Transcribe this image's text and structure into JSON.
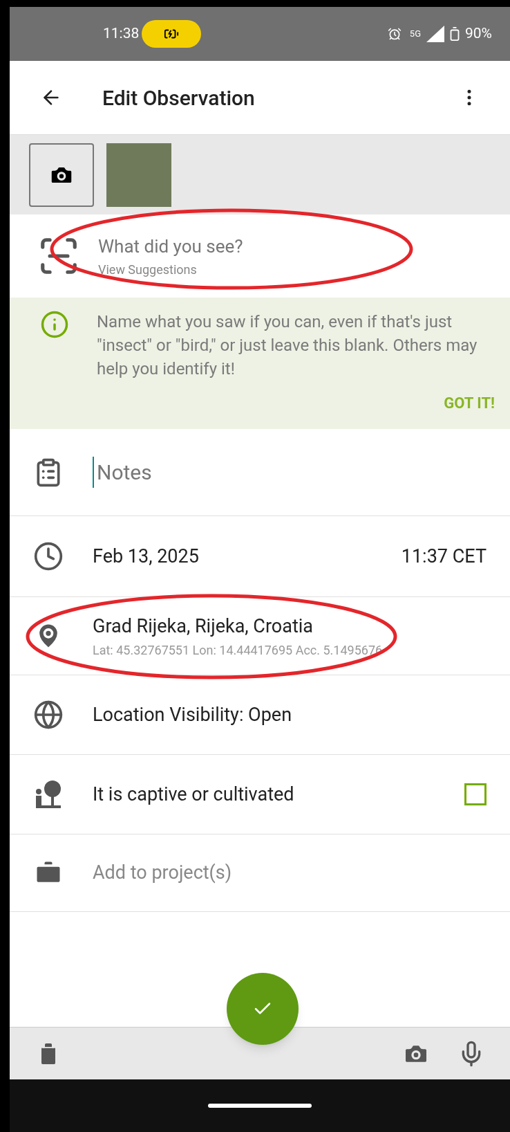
{
  "status_bar": {
    "time": "11:38",
    "network": "5G",
    "battery": "90%"
  },
  "app_bar": {
    "title": "Edit Observation"
  },
  "species": {
    "placeholder": "What did you see?",
    "link": "View Suggestions"
  },
  "tip": {
    "text": "Name what you saw if you can, even if that's just \"insect\" or \"bird,\" or just leave this blank. Others may help you identify it!",
    "action": "GOT IT!"
  },
  "notes": {
    "placeholder": "Notes"
  },
  "date": {
    "date": "Feb 13, 2025",
    "time": "11:37 CET"
  },
  "location": {
    "name": "Grad Rijeka, Rijeka, Croatia",
    "details": "Lat: 45.32767551 Lon: 14.44417695 Acc. 5.1495676"
  },
  "visibility": {
    "label": "Location Visibility: Open"
  },
  "captive": {
    "label": "It is captive or cultivated",
    "checked": false
  },
  "projects": {
    "placeholder": "Add to project(s)"
  }
}
